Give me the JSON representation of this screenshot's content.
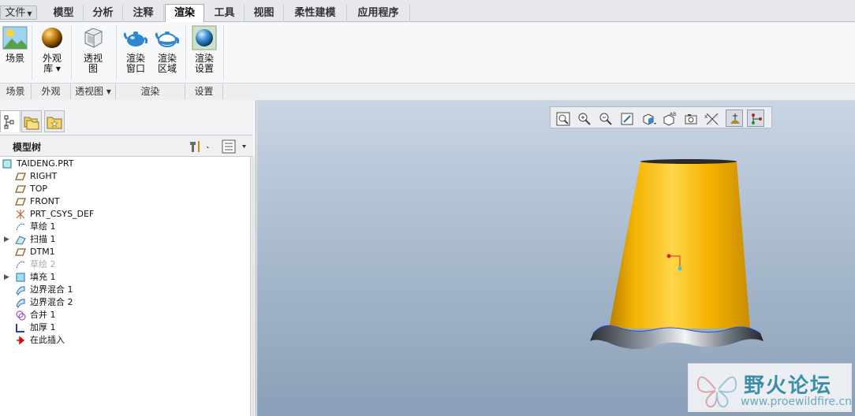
{
  "menu": {
    "file_label": "文件",
    "tabs": [
      "模型",
      "分析",
      "注释",
      "渲染",
      "工具",
      "视图",
      "柔性建模",
      "应用程序"
    ],
    "active_tab": "渲染"
  },
  "ribbon": {
    "buttons": {
      "scene": "场景",
      "appearance": "外观\n库 ▾",
      "perspective": "透视\n图",
      "render_window": "渲染\n窗口",
      "render_region": "渲染\n区域",
      "render_setup": "渲染\n设置"
    },
    "groups": {
      "scene": "场景",
      "appearance": "外观",
      "perspective": "透视图 ▾",
      "render": "渲染",
      "setup": "设置"
    }
  },
  "model_tree": {
    "title": "模型树",
    "items": [
      {
        "label": "TAIDENG.PRT",
        "icon": "part-icon"
      },
      {
        "label": "RIGHT",
        "icon": "datum-plane-icon"
      },
      {
        "label": "TOP",
        "icon": "datum-plane-icon"
      },
      {
        "label": "FRONT",
        "icon": "datum-plane-icon"
      },
      {
        "label": "PRT_CSYS_DEF",
        "icon": "csys-icon"
      },
      {
        "label": "草绘 1",
        "icon": "sketch-icon"
      },
      {
        "label": "扫描 1",
        "icon": "sweep-icon"
      },
      {
        "label": "DTM1",
        "icon": "datum-plane-icon"
      },
      {
        "label": "草绘 2",
        "icon": "sketch-icon"
      },
      {
        "label": "填充 1",
        "icon": "fill-icon"
      },
      {
        "label": "边界混合 1",
        "icon": "boundary-blend-icon"
      },
      {
        "label": "边界混合 2",
        "icon": "boundary-blend-icon"
      },
      {
        "label": "合并 1",
        "icon": "merge-icon"
      },
      {
        "label": "加厚 1",
        "icon": "thicken-icon"
      },
      {
        "label": "在此插入",
        "icon": "insert-here-icon"
      }
    ]
  },
  "watermark": {
    "title": "野火论坛",
    "url": "www.proewildfire.cn"
  },
  "colors": {
    "model_yellow": "#f5b400",
    "viewport_top": "#c8d5e4",
    "viewport_bottom": "#8aa0b8",
    "tab_active": "#ffffff"
  }
}
